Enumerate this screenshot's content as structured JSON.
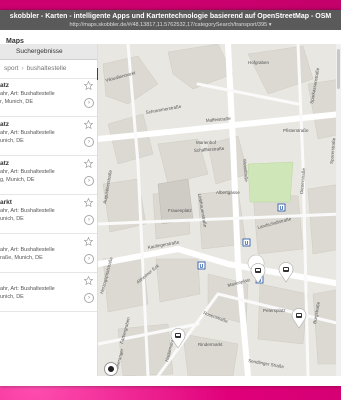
{
  "window": {
    "title": "skobbler - Karten - intelligente Apps und Kartentechnologie basierend auf OpenStreetMap - OSM",
    "url": "http://maps.skobbler.de/#/48.13817,11.5762532,17/categorySearch/transport/395 ▾"
  },
  "appbar": {
    "title": "Maps"
  },
  "sidebar": {
    "header": "Suchergebnisse",
    "breadcrumb": [
      "sport",
      "bushaltestelle"
    ],
    "results": [
      {
        "name": "atz",
        "line1": "",
        "line2": "ahr, Art: Bushaltestelle",
        "line3": "r, Munich, DE"
      },
      {
        "name": "atz",
        "line1": "",
        "line2": "ahr, Art: Bushaltestelle",
        "line3": "unich, DE"
      },
      {
        "name": "atz",
        "line1": "",
        "line2": "ahr, Art: Bushaltestelle",
        "line3": "g, Munich, DE"
      },
      {
        "name": "arkt",
        "line1": "",
        "line2": "ahr, Art: Bushaltestelle",
        "line3": "unich, DE"
      },
      {
        "name": "",
        "line1": "",
        "line2": "ahr, Art: Bushaltestelle",
        "line3": "raße, Munich, DE"
      },
      {
        "name": "",
        "line1": "",
        "line2": "ahr, Art: Bushaltestelle",
        "line3": "unich, DE"
      }
    ]
  },
  "map": {
    "street_labels": [
      {
        "text": "Viktualienmarkt"
      },
      {
        "text": "Schrammerstraße"
      },
      {
        "text": "Hofgraben"
      },
      {
        "text": "Pfisterstraße"
      },
      {
        "text": "Maffeistraße"
      },
      {
        "text": "Marienhof"
      },
      {
        "text": "Schäfflerstraße"
      },
      {
        "text": "Albertgasse"
      },
      {
        "text": "Frauenplatz"
      },
      {
        "text": "Landschaftstraße"
      },
      {
        "text": "Kaufingerstraße"
      },
      {
        "text": "Marienplatz"
      },
      {
        "text": "Petersplatz"
      },
      {
        "text": "Rosenstraße"
      },
      {
        "text": "Sendlinger Straße"
      },
      {
        "text": "Burgstraße"
      },
      {
        "text": "Augustinerstraße"
      },
      {
        "text": "Liebfrauenstraße"
      },
      {
        "text": "Sporerstraße"
      },
      {
        "text": "Weinstraße"
      },
      {
        "text": "Dienerstraße"
      },
      {
        "text": "Sparkassenstraße"
      },
      {
        "text": "Herzogspitalstraße"
      },
      {
        "text": "Färbergraben"
      },
      {
        "text": "Altheimer Eck"
      },
      {
        "text": "Rindermarkt"
      },
      {
        "text": "Hackenstraße"
      },
      {
        "text": "Oberanger"
      }
    ],
    "transit_u": "U",
    "pin_icon": "bus-icon"
  }
}
